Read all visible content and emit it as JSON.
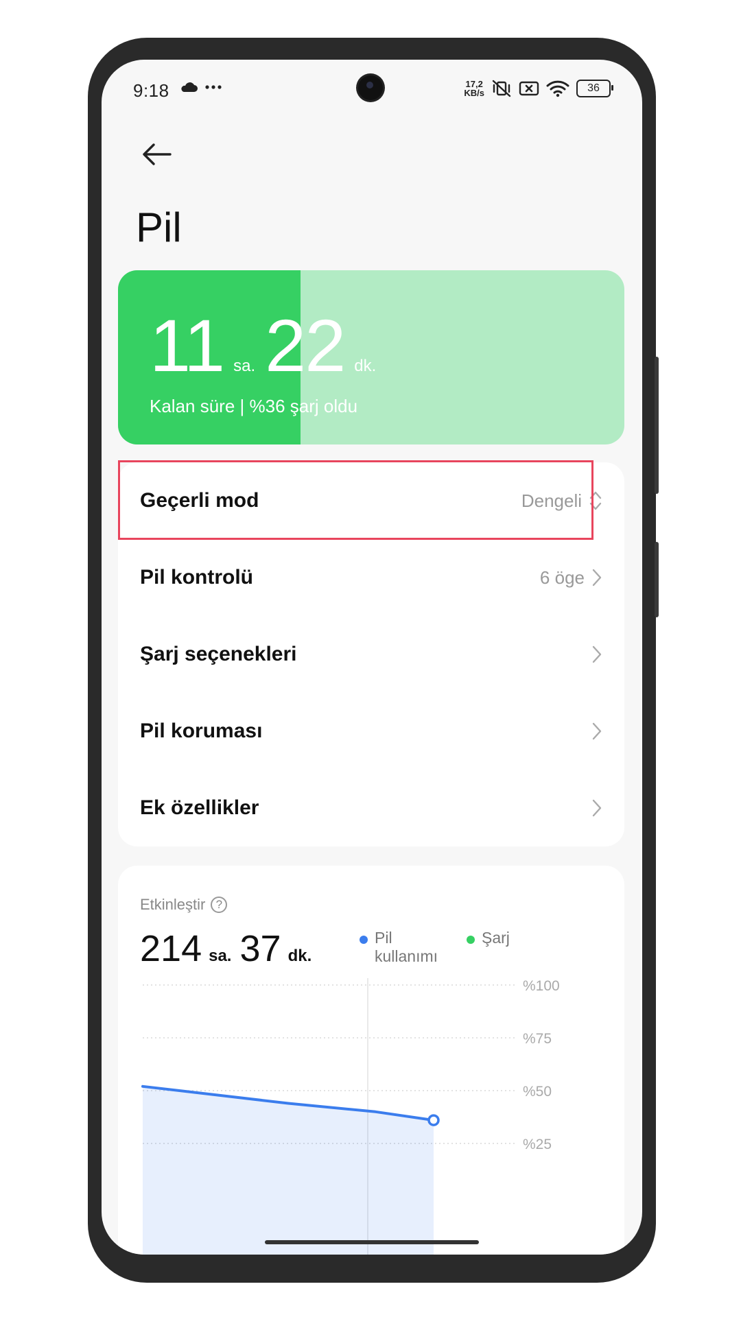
{
  "status_bar": {
    "time": "9:18",
    "net_speed_value": "17,2",
    "net_speed_unit": "KB/s",
    "battery_level": "36"
  },
  "page": {
    "title": "Pil"
  },
  "battery_card": {
    "hours": "11",
    "hours_unit": "sa.",
    "minutes": "22",
    "minutes_unit": "dk.",
    "subtitle": "Kalan süre | %36 şarj oldu",
    "charge_fraction": 0.36,
    "fill_color": "#36d063",
    "track_color": "#b2ebc4"
  },
  "menu": {
    "items": [
      {
        "label": "Geçerli mod",
        "value": "Dengeli",
        "icon": "up-down-arrows-icon"
      },
      {
        "label": "Pil kontrolü",
        "value": "6 öge",
        "icon": "chevron-right-icon"
      },
      {
        "label": "Şarj seçenekleri",
        "value": "",
        "icon": "chevron-right-icon"
      },
      {
        "label": "Pil koruması",
        "value": "",
        "icon": "chevron-right-icon"
      },
      {
        "label": "Ek özellikler",
        "value": "",
        "icon": "chevron-right-icon"
      }
    ]
  },
  "usage": {
    "title": "Etkinleştir",
    "hours": "214",
    "hours_unit": "sa.",
    "minutes": "37",
    "minutes_unit": "dk.",
    "legend": [
      {
        "label": "Pil kullanımı",
        "color": "#3b7ded"
      },
      {
        "label": "Şarj",
        "color": "#36d063"
      }
    ]
  },
  "chart_data": {
    "type": "area",
    "title": "",
    "xlabel": "",
    "ylabel": "",
    "y_ticks": [
      "%100",
      "%75",
      "%50",
      "%25"
    ],
    "ylim": [
      0,
      100
    ],
    "grid": true,
    "series": [
      {
        "name": "Pil kullanımı",
        "color": "#3b7ded",
        "x": [
          0,
          0.5,
          0.8,
          1.0
        ],
        "values": [
          52,
          44,
          40,
          36
        ]
      }
    ]
  }
}
